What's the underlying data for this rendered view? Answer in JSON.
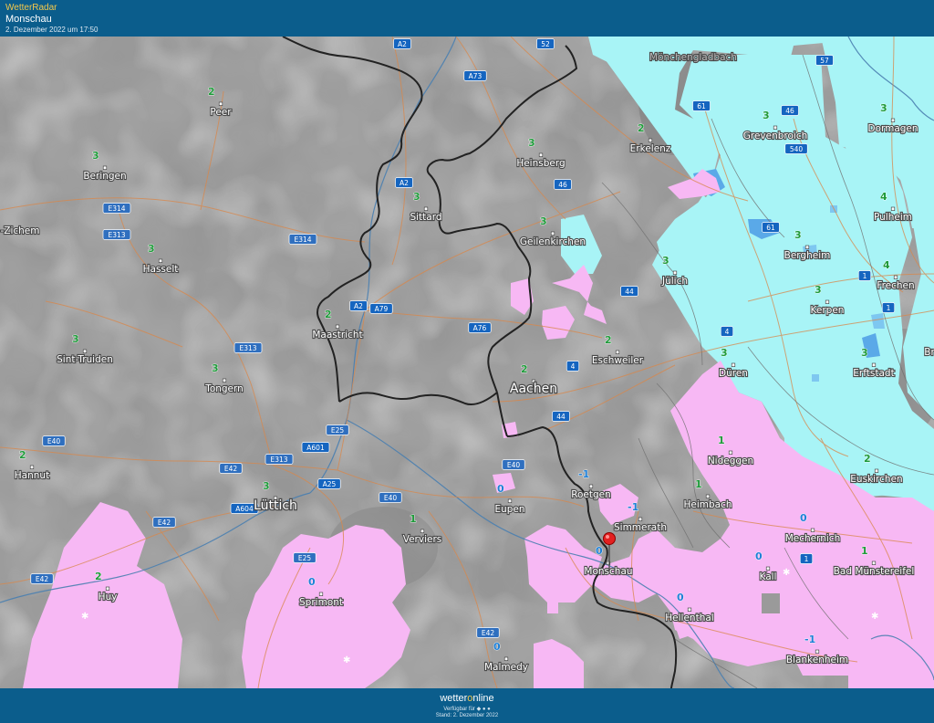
{
  "header": {
    "app_name": "WetterRadar",
    "location": "Monschau",
    "timestamp": "2. Dezember 2022 um 17:50"
  },
  "map": {
    "colors": {
      "no_precip": "#9a9a9a",
      "snow": "#a8f4f6",
      "mixed": "#f7b8f4",
      "moderate_snow": "#4fb0ee",
      "border": "#222222",
      "road": "#d9874a",
      "river": "#4a7fb0",
      "label_value": "#1f9a3a"
    },
    "cities": [
      {
        "name": "Peer",
        "value": "2"
      },
      {
        "name": "Beringen",
        "value": "3"
      },
      {
        "name": "-Zichem",
        "value": ""
      },
      {
        "name": "Hasselt",
        "value": "3"
      },
      {
        "name": "Sint-Truiden",
        "value": "3"
      },
      {
        "name": "Tongern",
        "value": "3"
      },
      {
        "name": "Hannut",
        "value": "2"
      },
      {
        "name": "Huy",
        "value": "2"
      },
      {
        "name": "Maastricht",
        "value": "2"
      },
      {
        "name": "Sittard",
        "value": "3"
      },
      {
        "name": "Heinsberg",
        "value": "3"
      },
      {
        "name": "Erkelenz",
        "value": "2"
      },
      {
        "name": "Geilenkirchen",
        "value": "3"
      },
      {
        "name": "Jülich",
        "value": "3"
      },
      {
        "name": "Eschweiler",
        "value": "2"
      },
      {
        "name": "Aachen",
        "value": "2"
      },
      {
        "name": "Lüttich",
        "value": "3"
      },
      {
        "name": "Verviers",
        "value": "1"
      },
      {
        "name": "Eupen",
        "value": "0"
      },
      {
        "name": "Roetgen",
        "value": "-1"
      },
      {
        "name": "Simmerath",
        "value": "-1"
      },
      {
        "name": "Monschau",
        "value": "0"
      },
      {
        "name": "Sprimont",
        "value": "0"
      },
      {
        "name": "Malmedy",
        "value": "0"
      },
      {
        "name": "Hellenthal",
        "value": "0"
      },
      {
        "name": "Kall",
        "value": "0"
      },
      {
        "name": "Mechernich",
        "value": "0"
      },
      {
        "name": "Bad Münstereifel",
        "value": "1"
      },
      {
        "name": "Blankenheim",
        "value": "-1"
      },
      {
        "name": "Heimbach",
        "value": "1"
      },
      {
        "name": "Nideggen",
        "value": "1"
      },
      {
        "name": "Düren",
        "value": "3"
      },
      {
        "name": "Euskirchen",
        "value": "2"
      },
      {
        "name": "Erftstadt",
        "value": "3"
      },
      {
        "name": "Kerpen",
        "value": "3"
      },
      {
        "name": "Frechen",
        "value": "4"
      },
      {
        "name": "Bergheim",
        "value": "3"
      },
      {
        "name": "Pulheim",
        "value": "4"
      },
      {
        "name": "Dormagen",
        "value": "3"
      },
      {
        "name": "Grevenbroich",
        "value": "3"
      },
      {
        "name": "Mönchengladbach",
        "value": ""
      },
      {
        "name": "Br",
        "value": ""
      }
    ],
    "roads": [
      "A2",
      "A73",
      "52",
      "57",
      "61",
      "46",
      "540",
      "A2",
      "46",
      "E314",
      "E313",
      "E314",
      "61",
      "4",
      "1",
      "A2",
      "A79",
      "A76",
      "44",
      "4",
      "E313",
      "E25",
      "A601",
      "E313",
      "E40",
      "44",
      "E40",
      "A25",
      "E40",
      "E42",
      "A604",
      "E42",
      "E25",
      "E42",
      "E42",
      "1",
      "1"
    ],
    "marker_location": "Monschau"
  },
  "footer": {
    "logo_a": "wetter",
    "logo_o": "o",
    "logo_b": "nline",
    "availability": "Verfügbar für ◆ ● ●",
    "stand": "Stand: 2. Dezember 2022"
  }
}
